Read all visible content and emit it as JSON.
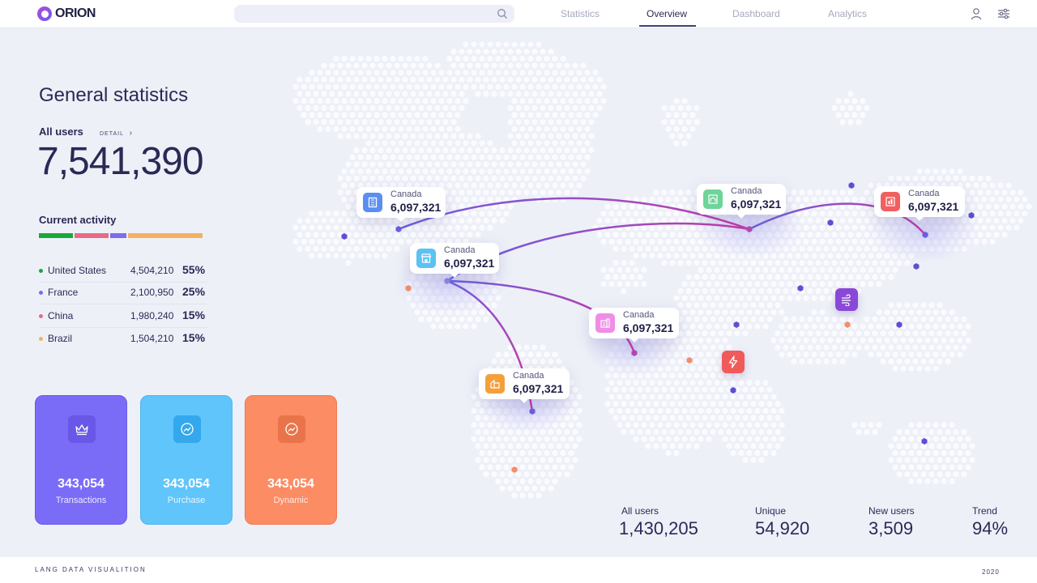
{
  "header": {
    "logo_text": "ORION",
    "search": {
      "value": "",
      "placeholder": ""
    },
    "nav": [
      "Statistics",
      "Overview",
      "Dashboard",
      "Analytics"
    ],
    "active_nav": "Overview"
  },
  "stats": {
    "title": "General statistics",
    "all_users_label": "All users",
    "detail_label": "DETAIL",
    "all_users_value": "7,541,390",
    "current_activity_label": "Current activity",
    "activity_bar_colors": [
      "#18a93b",
      "#e96a85",
      "#7b6cf0",
      "#f2b25f"
    ],
    "countries": [
      {
        "name": "United States",
        "value": "4,504,210",
        "pct": "55%",
        "color": "#18a93b"
      },
      {
        "name": "France",
        "value": "2,100,950",
        "pct": "25%",
        "color": "#7b6cf0"
      },
      {
        "name": "China",
        "value": "1,980,240",
        "pct": "15%",
        "color": "#e96a85"
      },
      {
        "name": "Brazil",
        "value": "1,504,210",
        "pct": "15%",
        "color": "#f2b25f"
      }
    ]
  },
  "cards": [
    {
      "value": "343,054",
      "label": "Transactions",
      "icon": "crown-icon",
      "color": "#7b6cf8"
    },
    {
      "value": "343,054",
      "label": "Purchase",
      "icon": "trend-circle-icon",
      "color": "#5fc5fb"
    },
    {
      "value": "343,054",
      "label": "Dynamic",
      "icon": "trend-circle-icon",
      "color": "#fb8c64"
    }
  ],
  "map_popups": [
    {
      "name": "Canada",
      "value": "6,097,321",
      "icon": "building-icon",
      "color": "#5a8ff2"
    },
    {
      "name": "Canada",
      "value": "6,097,321",
      "icon": "store-icon",
      "color": "#5cc2f2"
    },
    {
      "name": "Canada",
      "value": "6,097,321",
      "icon": "house-icon",
      "color": "#f3a03c"
    },
    {
      "name": "Canada",
      "value": "6,097,321",
      "icon": "building-icon",
      "color": "#ee8ee6"
    },
    {
      "name": "Canada",
      "value": "6,097,321",
      "icon": "house-icon",
      "color": "#6fd49a"
    },
    {
      "name": "Canada",
      "value": "6,097,321",
      "icon": "building-icon",
      "color": "#f06060"
    }
  ],
  "map_icons": [
    {
      "icon": "wind-icon",
      "color": "#8a48d6"
    },
    {
      "icon": "lightning-icon",
      "color": "#f05a5a"
    }
  ],
  "bottom_stats": [
    {
      "label": "All users",
      "value": "1,430,205"
    },
    {
      "label": "Unique",
      "value": "54,920"
    },
    {
      "label": "New users",
      "value": "3,509"
    },
    {
      "label": "Trend",
      "value": "94%"
    }
  ],
  "footer": {
    "left": "LANG DATA VISUALITION",
    "right": "2020"
  }
}
